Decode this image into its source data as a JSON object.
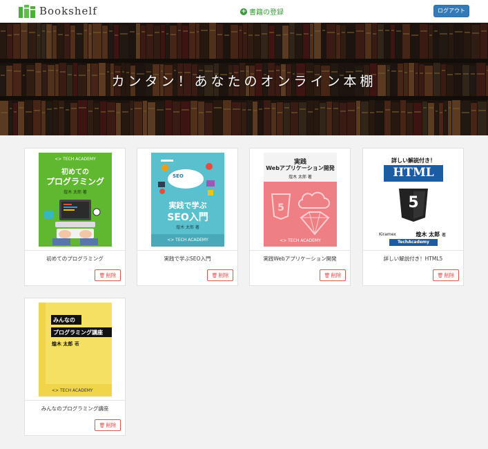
{
  "header": {
    "brand": "Bookshelf",
    "register_label": "書籍の登録",
    "logout_label": "ログアウト"
  },
  "hero": {
    "title": "カンタン！あなたのオンライン本棚"
  },
  "books": [
    {
      "title": "初めてのプログラミング",
      "cover_publisher": "<> TECH ACADEMY",
      "cover_title_line1": "初めての",
      "cover_title_line2": "プログラミング",
      "cover_author": "煌木 太郎",
      "cover_author_suffix": "著",
      "cover_color": "#5fb82f"
    },
    {
      "title": "実践で学ぶSEO入門",
      "cover_title_line1": "実践で学ぶ",
      "cover_title_line2": "SEO入門",
      "cover_author": "煌木 太郎",
      "cover_author_suffix": "著",
      "cover_publisher": "<> TECH ACADEMY",
      "cover_badge": "SEO",
      "cover_color": "#5bc0ce"
    },
    {
      "title": "実践Webアプリケーション開発",
      "cover_title_line1": "実践",
      "cover_title_line2": "Webアプリケーション開発",
      "cover_author": "煌木 太郎",
      "cover_author_suffix": "著",
      "cover_publisher": "<> TECH ACADEMY",
      "cover_color": "#ee7f85"
    },
    {
      "title": "詳しい解説付き！HTML5",
      "cover_title_line1": "詳しい解説付き！",
      "cover_title_line2": "HTML",
      "cover_badge": "5",
      "cover_publisher_left": "Kiramex",
      "cover_author": "煌木 太郎",
      "cover_author_suffix": "著",
      "cover_publisher": "TechAcademy",
      "cover_color": "#ffffff"
    },
    {
      "title": "みんなのプログラミング講座",
      "cover_title_line1": "みんなの",
      "cover_title_line2": "プログラミング講座",
      "cover_author": "煌木 太郎",
      "cover_author_suffix": "著",
      "cover_publisher": "<> TECH ACADEMY",
      "cover_color": "#f5e063"
    }
  ],
  "delete_label": "削除",
  "delete_icon": "trash-icon",
  "colors": {
    "accent_green": "#3a9a3a",
    "logout_blue": "#337ab7",
    "delete_red": "#d9534f"
  }
}
